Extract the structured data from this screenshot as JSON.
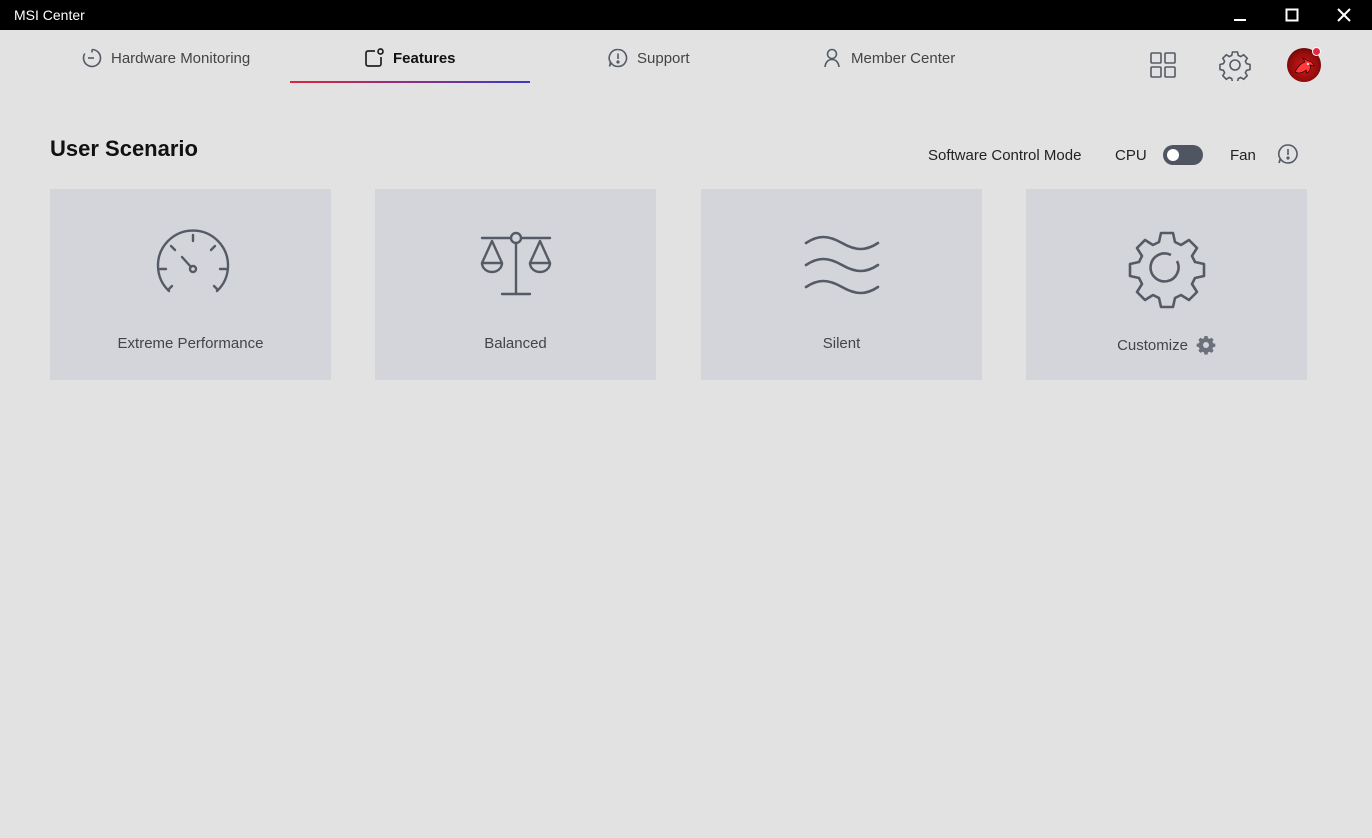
{
  "window": {
    "title": "MSI Center",
    "controls": {
      "minimize": "minimize-icon",
      "maximize": "maximize-icon",
      "close": "close-icon"
    }
  },
  "nav": {
    "tabs": [
      {
        "label": "Hardware Monitoring",
        "icon": "hardware-monitoring-icon",
        "active": false
      },
      {
        "label": "Features",
        "icon": "features-icon",
        "active": true
      },
      {
        "label": "Support",
        "icon": "support-icon",
        "active": false
      },
      {
        "label": "Member Center",
        "icon": "member-icon",
        "active": false
      }
    ],
    "actions": [
      "apps-grid-icon",
      "settings-gear-icon",
      "user-avatar"
    ]
  },
  "scenario": {
    "title": "User Scenario",
    "software_control_mode": "Software Control Mode",
    "cpu_label": "CPU",
    "fan_label": "Fan",
    "toggle_state": "off",
    "cards": [
      {
        "label": "Extreme Performance",
        "icon": "speedometer-icon"
      },
      {
        "label": "Balanced",
        "icon": "balance-scale-icon"
      },
      {
        "label": "Silent",
        "icon": "waves-icon"
      },
      {
        "label": "Customize",
        "icon": "gear-icon"
      }
    ]
  },
  "colors": {
    "accent_start": "#e0243c",
    "accent_end": "#3a39c8",
    "card_bg": "#d4d5da",
    "icon_stroke": "#555b66"
  }
}
